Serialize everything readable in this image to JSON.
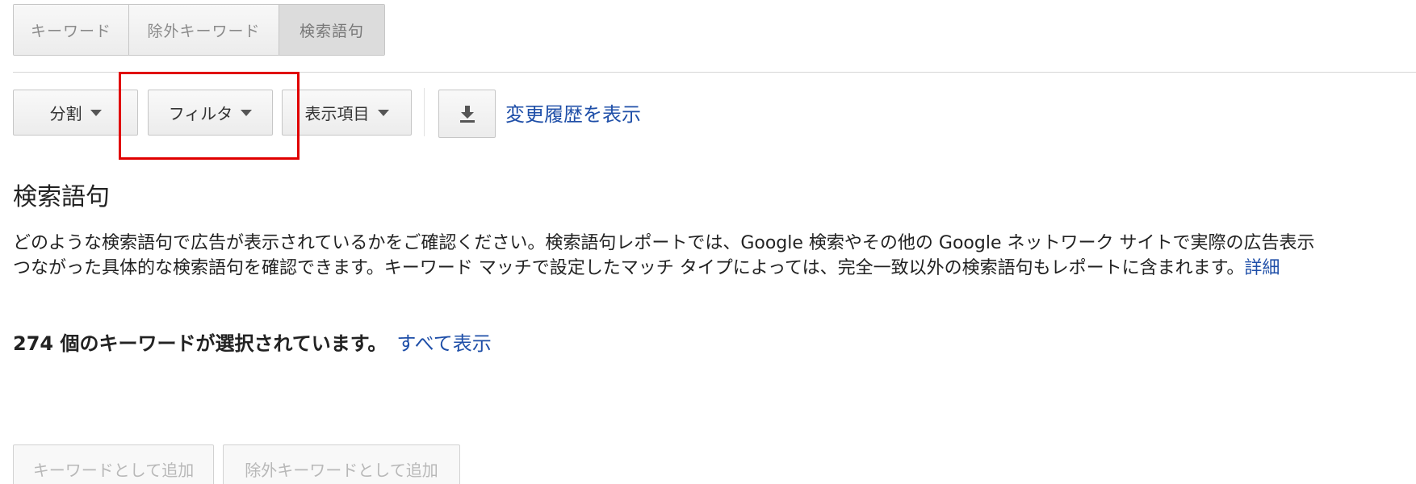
{
  "tabs": [
    {
      "label": "キーワード",
      "active": false
    },
    {
      "label": "除外キーワード",
      "active": false
    },
    {
      "label": "検索語句",
      "active": true
    }
  ],
  "toolbar": {
    "split_label": "分割",
    "filter_label": "フィルタ",
    "columns_label": "表示項目",
    "download_icon": "download-icon",
    "history_link": "変更履歴を表示"
  },
  "section": {
    "title": "検索語句",
    "description_line1": "どのような検索語句で広告が表示されているかをご確認ください。検索語句レポートでは、Google 検索やその他の Google ネットワーク サイトで実際の広告表示",
    "description_line2": "つながった具体的な検索語句を確認できます。キーワード マッチで設定したマッチ タイプによっては、完全一致以外の検索語句もレポートに含まれます。",
    "detail_link": "詳細"
  },
  "selection": {
    "count_text": "274 個のキーワードが選択されています。",
    "show_all_link": "すべて表示"
  },
  "actions": {
    "add_as_keyword": "キーワードとして追加",
    "add_as_negative": "除外キーワードとして追加"
  },
  "colors": {
    "link": "#1f4fa8",
    "highlight": "#e00000"
  }
}
